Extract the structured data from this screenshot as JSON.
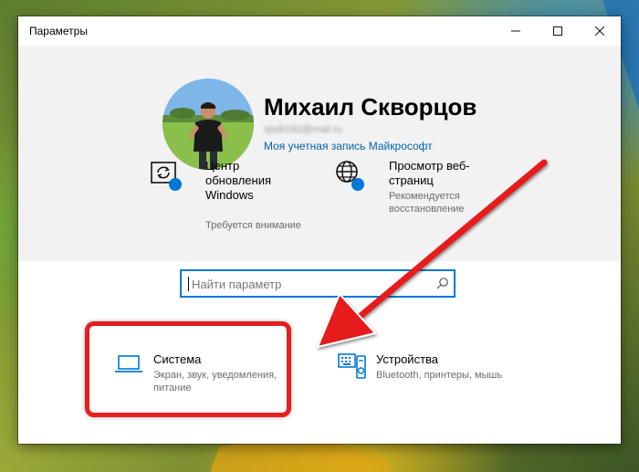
{
  "window": {
    "title": "Параметры",
    "controls": {
      "minimize": "—",
      "maximize": "☐",
      "close": "✕"
    }
  },
  "account": {
    "name": "Михаил Скворцов",
    "email": "sjsdr242@mail.ru",
    "link": "Моя учетная запись Майкрософт",
    "avatar_icon": "user-photo"
  },
  "tiles": [
    {
      "icon": "windows-update-icon",
      "title": "Центр обновления Windows",
      "subtitle": "Требуется внимание"
    },
    {
      "icon": "globe-icon",
      "title": "Просмотр веб-страниц",
      "subtitle": "Рекомендуется восстановление"
    }
  ],
  "search": {
    "placeholder": "Найти параметр",
    "value": ""
  },
  "categories": [
    {
      "icon": "laptop-icon",
      "title": "Система",
      "subtitle": "Экран, звук, уведомления, питание"
    },
    {
      "icon": "devices-icon",
      "title": "Устройства",
      "subtitle": "Bluetooth, принтеры, мышь"
    }
  ],
  "colors": {
    "accent": "#0078d7",
    "link": "#0063b1",
    "annotation_red": "#e61e1e",
    "header_bg": "#f2f2f2"
  }
}
